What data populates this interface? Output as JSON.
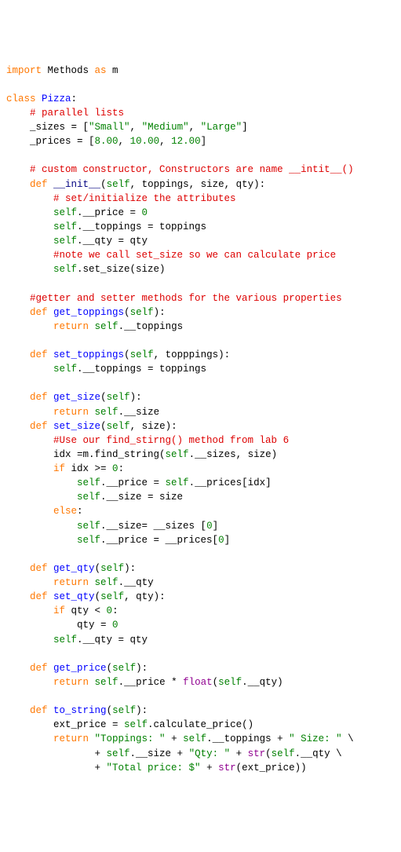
{
  "lines": [
    [
      [
        "kw",
        "import"
      ],
      [
        "blk",
        " Methods "
      ],
      [
        "kw",
        "as"
      ],
      [
        "blk",
        " m"
      ]
    ],
    [
      [
        "blk",
        ""
      ]
    ],
    [
      [
        "kw",
        "class"
      ],
      [
        "blk",
        " "
      ],
      [
        "blu",
        "Pizza"
      ],
      [
        "blk",
        ":"
      ]
    ],
    [
      [
        "blk",
        "    "
      ],
      [
        "red",
        "# parallel lists"
      ]
    ],
    [
      [
        "blk",
        "    _sizes = ["
      ],
      [
        "grn",
        "\"Small\""
      ],
      [
        "blk",
        ", "
      ],
      [
        "grn",
        "\"Medium\""
      ],
      [
        "blk",
        ", "
      ],
      [
        "grn",
        "\"Large\""
      ],
      [
        "blk",
        "]"
      ]
    ],
    [
      [
        "blk",
        "    _prices = ["
      ],
      [
        "grn",
        "8.00"
      ],
      [
        "blk",
        ", "
      ],
      [
        "grn",
        "10.00"
      ],
      [
        "blk",
        ", "
      ],
      [
        "grn",
        "12.00"
      ],
      [
        "blk",
        "]"
      ]
    ],
    [
      [
        "blk",
        ""
      ]
    ],
    [
      [
        "blk",
        "    "
      ],
      [
        "red",
        "# custom constructor, Constructors are name __intit__()"
      ]
    ],
    [
      [
        "blk",
        "    "
      ],
      [
        "kw",
        "def"
      ],
      [
        "blk",
        " "
      ],
      [
        "nvy",
        "__init__"
      ],
      [
        "blk",
        "("
      ],
      [
        "grn",
        "self"
      ],
      [
        "blk",
        ", toppings, size, qty):"
      ]
    ],
    [
      [
        "blk",
        "        "
      ],
      [
        "red",
        "# set/initialize the attributes"
      ]
    ],
    [
      [
        "blk",
        "        "
      ],
      [
        "grn",
        "self"
      ],
      [
        "blk",
        ".__price = "
      ],
      [
        "grn",
        "0"
      ]
    ],
    [
      [
        "blk",
        "        "
      ],
      [
        "grn",
        "self"
      ],
      [
        "blk",
        ".__toppings = toppings"
      ]
    ],
    [
      [
        "blk",
        "        "
      ],
      [
        "grn",
        "self"
      ],
      [
        "blk",
        ".__qty = qty"
      ]
    ],
    [
      [
        "blk",
        "        "
      ],
      [
        "red",
        "#note we call set_size so we can calculate price"
      ]
    ],
    [
      [
        "blk",
        "        "
      ],
      [
        "grn",
        "self"
      ],
      [
        "blk",
        ".set_size(size)"
      ]
    ],
    [
      [
        "blk",
        ""
      ]
    ],
    [
      [
        "blk",
        "    "
      ],
      [
        "red",
        "#getter and setter methods for the various properties"
      ]
    ],
    [
      [
        "blk",
        "    "
      ],
      [
        "kw",
        "def"
      ],
      [
        "blk",
        " "
      ],
      [
        "blu",
        "get_toppings"
      ],
      [
        "blk",
        "("
      ],
      [
        "grn",
        "self"
      ],
      [
        "blk",
        "):"
      ]
    ],
    [
      [
        "blk",
        "        "
      ],
      [
        "kw",
        "return"
      ],
      [
        "blk",
        " "
      ],
      [
        "grn",
        "self"
      ],
      [
        "blk",
        ".__toppings"
      ]
    ],
    [
      [
        "blk",
        ""
      ]
    ],
    [
      [
        "blk",
        "    "
      ],
      [
        "kw",
        "def"
      ],
      [
        "blk",
        " "
      ],
      [
        "blu",
        "set_toppings"
      ],
      [
        "blk",
        "("
      ],
      [
        "grn",
        "self"
      ],
      [
        "blk",
        ", topppings):"
      ]
    ],
    [
      [
        "blk",
        "        "
      ],
      [
        "grn",
        "self"
      ],
      [
        "blk",
        ".__toppings = toppings"
      ]
    ],
    [
      [
        "blk",
        ""
      ]
    ],
    [
      [
        "blk",
        "    "
      ],
      [
        "kw",
        "def"
      ],
      [
        "blk",
        " "
      ],
      [
        "blu",
        "get_size"
      ],
      [
        "blk",
        "("
      ],
      [
        "grn",
        "self"
      ],
      [
        "blk",
        "):"
      ]
    ],
    [
      [
        "blk",
        "        "
      ],
      [
        "kw",
        "return"
      ],
      [
        "blk",
        " "
      ],
      [
        "grn",
        "self"
      ],
      [
        "blk",
        ".__size"
      ]
    ],
    [
      [
        "blk",
        "    "
      ],
      [
        "kw",
        "def"
      ],
      [
        "blk",
        " "
      ],
      [
        "blu",
        "set_size"
      ],
      [
        "blk",
        "("
      ],
      [
        "grn",
        "self"
      ],
      [
        "blk",
        ", size):"
      ]
    ],
    [
      [
        "blk",
        "        "
      ],
      [
        "red",
        "#Use our find_stirng() method from lab 6"
      ]
    ],
    [
      [
        "blk",
        "        idx =m.find_string("
      ],
      [
        "grn",
        "self"
      ],
      [
        "blk",
        ".__sizes, size)"
      ]
    ],
    [
      [
        "blk",
        "        "
      ],
      [
        "kw",
        "if"
      ],
      [
        "blk",
        " idx >= "
      ],
      [
        "grn",
        "0"
      ],
      [
        "blk",
        ":"
      ]
    ],
    [
      [
        "blk",
        "            "
      ],
      [
        "grn",
        "self"
      ],
      [
        "blk",
        ".__price = "
      ],
      [
        "grn",
        "self"
      ],
      [
        "blk",
        ".__prices[idx]"
      ]
    ],
    [
      [
        "blk",
        "            "
      ],
      [
        "grn",
        "self"
      ],
      [
        "blk",
        ".__size = size"
      ]
    ],
    [
      [
        "blk",
        "        "
      ],
      [
        "kw",
        "else"
      ],
      [
        "blk",
        ":"
      ]
    ],
    [
      [
        "blk",
        "            "
      ],
      [
        "grn",
        "self"
      ],
      [
        "blk",
        ".__size= __sizes ["
      ],
      [
        "grn",
        "0"
      ],
      [
        "blk",
        "]"
      ]
    ],
    [
      [
        "blk",
        "            "
      ],
      [
        "grn",
        "self"
      ],
      [
        "blk",
        ".__price = __prices["
      ],
      [
        "grn",
        "0"
      ],
      [
        "blk",
        "]"
      ]
    ],
    [
      [
        "blk",
        ""
      ]
    ],
    [
      [
        "blk",
        "    "
      ],
      [
        "kw",
        "def"
      ],
      [
        "blk",
        " "
      ],
      [
        "blu",
        "get_qty"
      ],
      [
        "blk",
        "("
      ],
      [
        "grn",
        "self"
      ],
      [
        "blk",
        "):"
      ]
    ],
    [
      [
        "blk",
        "        "
      ],
      [
        "kw",
        "return"
      ],
      [
        "blk",
        " "
      ],
      [
        "grn",
        "self"
      ],
      [
        "blk",
        ".__qty"
      ]
    ],
    [
      [
        "blk",
        "    "
      ],
      [
        "kw",
        "def"
      ],
      [
        "blk",
        " "
      ],
      [
        "blu",
        "set_qty"
      ],
      [
        "blk",
        "("
      ],
      [
        "grn",
        "self"
      ],
      [
        "blk",
        ", qty):"
      ]
    ],
    [
      [
        "blk",
        "        "
      ],
      [
        "kw",
        "if"
      ],
      [
        "blk",
        " qty < "
      ],
      [
        "grn",
        "0"
      ],
      [
        "blk",
        ":"
      ]
    ],
    [
      [
        "blk",
        "            qty = "
      ],
      [
        "grn",
        "0"
      ]
    ],
    [
      [
        "blk",
        "        "
      ],
      [
        "grn",
        "self"
      ],
      [
        "blk",
        ".__qty = qty"
      ]
    ],
    [
      [
        "blk",
        ""
      ]
    ],
    [
      [
        "blk",
        "    "
      ],
      [
        "kw",
        "def"
      ],
      [
        "blk",
        " "
      ],
      [
        "blu",
        "get_price"
      ],
      [
        "blk",
        "("
      ],
      [
        "grn",
        "self"
      ],
      [
        "blk",
        "):"
      ]
    ],
    [
      [
        "blk",
        "        "
      ],
      [
        "kw",
        "return"
      ],
      [
        "blk",
        " "
      ],
      [
        "grn",
        "self"
      ],
      [
        "blk",
        ".__price * "
      ],
      [
        "pur",
        "float"
      ],
      [
        "blk",
        "("
      ],
      [
        "grn",
        "self"
      ],
      [
        "blk",
        ".__qty)"
      ]
    ],
    [
      [
        "blk",
        ""
      ]
    ],
    [
      [
        "blk",
        "    "
      ],
      [
        "kw",
        "def"
      ],
      [
        "blk",
        " "
      ],
      [
        "blu",
        "to_string"
      ],
      [
        "blk",
        "("
      ],
      [
        "grn",
        "self"
      ],
      [
        "blk",
        "):"
      ]
    ],
    [
      [
        "blk",
        "        ext_price = "
      ],
      [
        "grn",
        "self"
      ],
      [
        "blk",
        ".calculate_price()"
      ]
    ],
    [
      [
        "blk",
        "        "
      ],
      [
        "kw",
        "return"
      ],
      [
        "blk",
        " "
      ],
      [
        "grn",
        "\"Toppings: \""
      ],
      [
        "blk",
        " + "
      ],
      [
        "grn",
        "self"
      ],
      [
        "blk",
        ".__toppings + "
      ],
      [
        "grn",
        "\" Size: \""
      ],
      [
        "blk",
        " \\"
      ]
    ],
    [
      [
        "blk",
        "               + "
      ],
      [
        "grn",
        "self"
      ],
      [
        "blk",
        ".__size + "
      ],
      [
        "grn",
        "\"Qty: \""
      ],
      [
        "blk",
        " + "
      ],
      [
        "pur",
        "str"
      ],
      [
        "blk",
        "("
      ],
      [
        "grn",
        "self"
      ],
      [
        "blk",
        ".__qty \\"
      ]
    ],
    [
      [
        "blk",
        "               + "
      ],
      [
        "grn",
        "\"Total price: $\""
      ],
      [
        "blk",
        " + "
      ],
      [
        "pur",
        "str"
      ],
      [
        "blk",
        "(ext_price))"
      ]
    ]
  ]
}
